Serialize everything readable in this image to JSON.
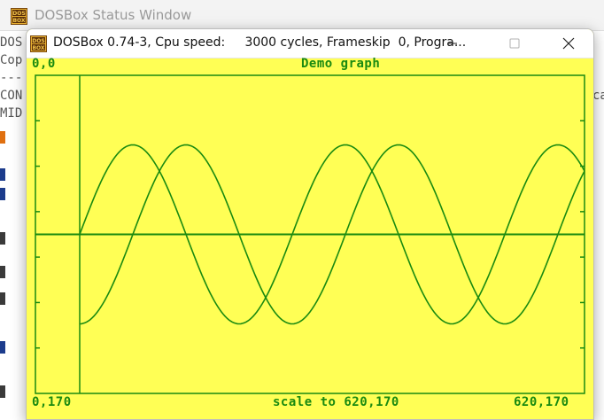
{
  "status_window": {
    "title": "DOSBox Status Window",
    "lines": [
      "DOS",
      "Cop",
      "---",
      "CON",
      "MID"
    ],
    "right_fragment": "ca"
  },
  "dosbox_window": {
    "title": "DOSBox 0.74-3, Cpu speed:     3000 cycles, Frameskip  0, Progra..."
  },
  "dos_screen": {
    "top_left": "0,0",
    "title": "Demo graph",
    "bottom_left": "0,170",
    "bottom_center": "scale to 620,170",
    "bottom_right": "620,170"
  },
  "colors": {
    "screen_bg": "#ffff55",
    "graph": "#1a8a10"
  },
  "chart_data": {
    "type": "line",
    "title": "Demo graph",
    "x": [
      0,
      20,
      40,
      60,
      80,
      100,
      120,
      140,
      160,
      180,
      200,
      220,
      240,
      260,
      280,
      300,
      320,
      340,
      360,
      380,
      400,
      420,
      440,
      460,
      480,
      500,
      520,
      540,
      560,
      570
    ],
    "series": [
      {
        "values": [
          0,
          0.5,
          0.87,
          1,
          0.87,
          0.5,
          0,
          -0.5,
          -0.87,
          -1,
          -0.87,
          -0.5,
          0,
          0.5,
          0.87,
          1,
          0.87,
          0.5,
          0,
          -0.5,
          -0.87,
          -1,
          -0.87,
          -0.5,
          0,
          0.5,
          0.87,
          1,
          0.87,
          0.5
        ]
      },
      {
        "values": [
          -1,
          -0.87,
          -0.5,
          0,
          0.5,
          0.87,
          1,
          0.87,
          0.5,
          0,
          -0.5,
          -0.87,
          -1,
          -0.87,
          -0.5,
          0,
          0.5,
          0.87,
          1,
          0.87,
          0.5,
          0,
          -0.5,
          -0.87,
          -1,
          -0.87,
          -0.5,
          0,
          0.5,
          0.87
        ]
      }
    ],
    "ylim": [
      -1,
      1
    ],
    "grid": false
  }
}
